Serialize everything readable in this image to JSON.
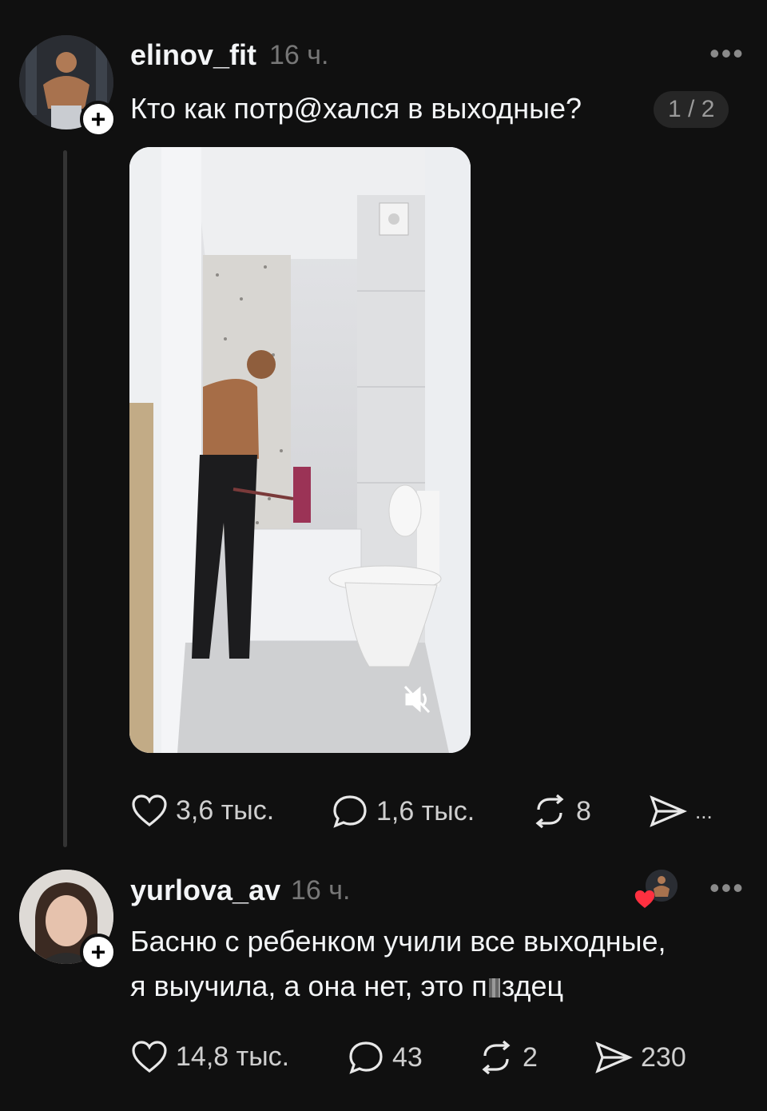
{
  "post": {
    "username": "elinov_fit",
    "time": "16 ч.",
    "text": "Кто как потр@хался в выходные?",
    "page_indicator": "1 / 2",
    "stats": {
      "likes": "3,6 тыс.",
      "comments": "1,6 тыс.",
      "reposts": "8",
      "shares": "..."
    }
  },
  "reply": {
    "username": "yurlova_av",
    "time": "16 ч.",
    "text_line1": "Басню с ребенком учили все выходные,",
    "text_line2_a": "я выучила, а она нет, это п",
    "text_line2_b": "здец",
    "stats": {
      "likes": "14,8 тыс.",
      "comments": "43",
      "reposts": "2",
      "shares": "230"
    }
  },
  "colors": {
    "background": "#101010",
    "heart_red": "#ff3040",
    "muted": "#777777"
  },
  "icons": [
    "heart-icon",
    "comment-icon",
    "repost-icon",
    "share-icon",
    "more-icon",
    "plus-icon",
    "mute-icon"
  ]
}
